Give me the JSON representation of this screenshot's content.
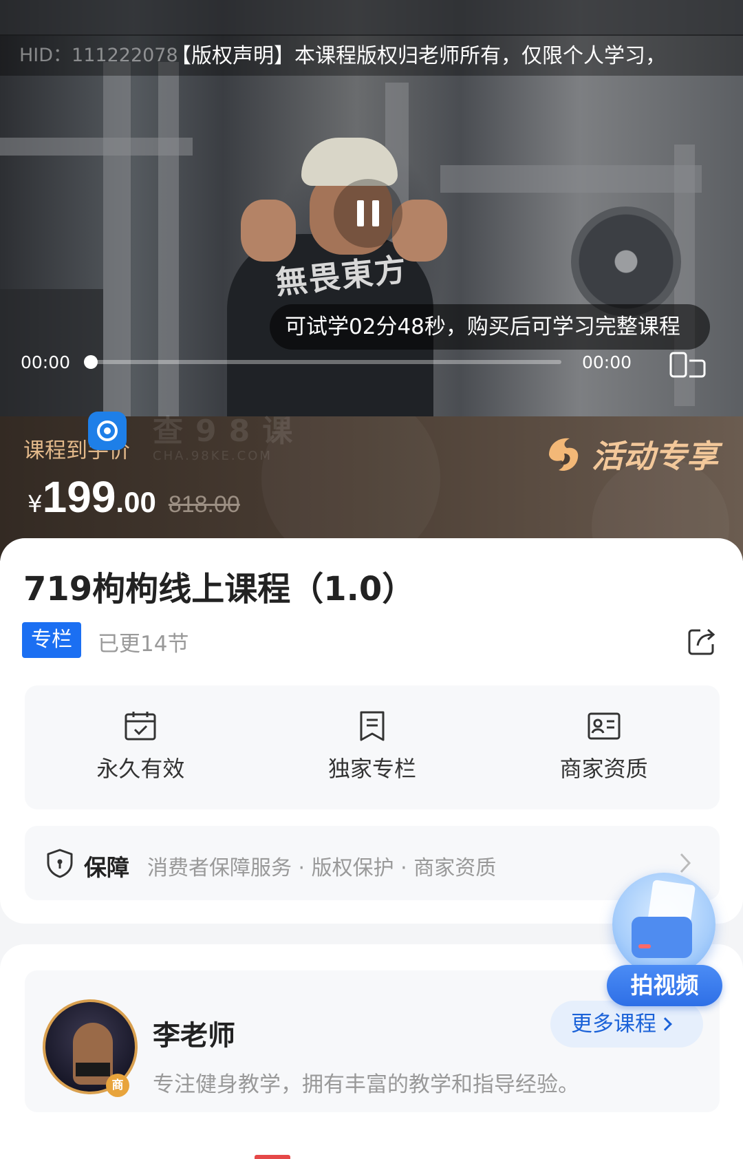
{
  "video": {
    "hid": "HID：111222078",
    "copyright": "【版权声明】本课程版权归老师所有，仅限个人学习，",
    "shirt_print": "無畏東方",
    "trial_notice": "可试学02分48秒，购买后可学习完整课程",
    "time_current": "00:00",
    "time_total": "00:00",
    "progress": 0
  },
  "banner": {
    "label": "课程到手价",
    "currency": "¥",
    "price_int": "199",
    "price_dec": ".00",
    "original_price": "818.00",
    "promo_label": "活动专享",
    "watermark": "查98课",
    "watermark_sub": "CHA.98KE.COM"
  },
  "course": {
    "title": "719枸枸线上课程（1.0）",
    "tag": "专栏",
    "updated": "已更14节"
  },
  "features": [
    {
      "icon": "calendar-check-icon",
      "label": "永久有效"
    },
    {
      "icon": "bookmark-icon",
      "label": "独家专栏"
    },
    {
      "icon": "id-card-icon",
      "label": "商家资质"
    }
  ],
  "guarantee": {
    "title": "保障",
    "items": "消费者保障服务 · 版权保护 · 商家资质"
  },
  "teacher": {
    "name": "李老师",
    "desc": "专注健身教学，拥有丰富的教学和指导经验。",
    "badge": "商",
    "more_label": "更多课程"
  },
  "fab": {
    "label": "拍视频"
  },
  "colors": {
    "accent_blue": "#1b6ff2",
    "promo_gold": "#f3c89a",
    "banner_dark": "#332a23"
  }
}
